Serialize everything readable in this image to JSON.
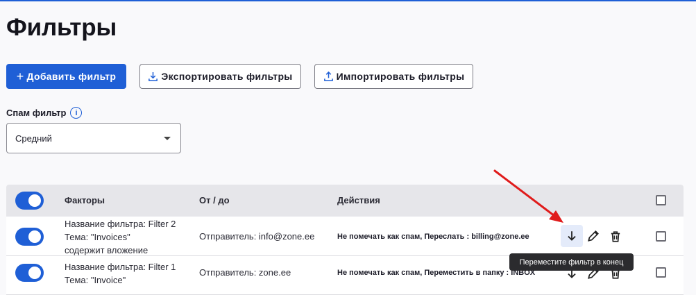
{
  "page": {
    "title": "Фильтры"
  },
  "toolbar": {
    "add_label": "Добавить фильтр",
    "export_label": "Экспортировать фильтры",
    "import_label": "Импортировать фильтры"
  },
  "spam": {
    "label": "Спам фильтр",
    "info_glyph": "i",
    "selected": "Средний"
  },
  "table": {
    "headers": {
      "factors": "Факторы",
      "from_to": "От / до",
      "actions": "Действия"
    },
    "rows": [
      {
        "enabled": true,
        "factors": [
          "Название фильтра: Filter 2",
          "Тема: \"Invoices\"",
          "содержит вложение"
        ],
        "from_to": "Отправитель: info@zone.ee",
        "actions": "Не помечать как спам, Переслать : billing@zone.ee"
      },
      {
        "enabled": true,
        "factors": [
          "Название фильтра: Filter 1",
          "Тема: \"Invoice\""
        ],
        "from_to": "Отправитель: zone.ee",
        "actions": "Не помечать как спам, Переместить в папку : INBOX"
      }
    ]
  },
  "tooltip": {
    "text": "Переместите фильтр в конец"
  },
  "colors": {
    "accent": "#1f5fd6",
    "annotation_arrow": "#e01b1b"
  }
}
